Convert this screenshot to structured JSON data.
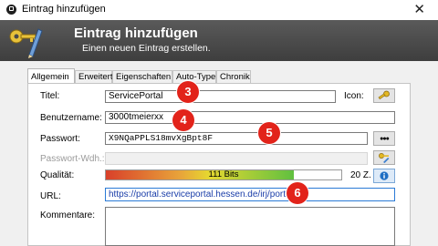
{
  "window": {
    "title": "Eintrag hinzufügen",
    "close_glyph": "✕"
  },
  "banner": {
    "title": "Eintrag hinzufügen",
    "subtitle": "Einen neuen Eintrag erstellen.",
    "icon": "key-pen-icon"
  },
  "tabs": [
    {
      "label": "Allgemein",
      "active": true
    },
    {
      "label": "Erweitert",
      "active": false
    },
    {
      "label": "Eigenschaften",
      "active": false
    },
    {
      "label": "Auto-Type",
      "active": false
    },
    {
      "label": "Chronik",
      "active": false
    }
  ],
  "form": {
    "title_label": "Titel:",
    "title_value": "ServicePortal",
    "icon_label": "Icon:",
    "username_label": "Benutzername:",
    "username_value": "3000tmeierxx",
    "password_label": "Passwort:",
    "password_value": "X9NQaPPLS18mvXgBpt8F",
    "password_repeat_label": "Passwort-Wdh.:",
    "quality_label": "Qualität:",
    "quality_text": "111 Bits",
    "quality_fraction": 0.8,
    "quality_chars": "20 Z.",
    "url_label": "URL:",
    "url_value": "https://portal.serviceportal.hessen.de/irj/portal",
    "comments_label": "Kommentare:"
  },
  "buttons": {
    "show_password_glyph": "●●●"
  },
  "badges": [
    "3",
    "4",
    "5",
    "6"
  ],
  "colors": {
    "badge": "#e2231a",
    "banner": "#4a4a4a",
    "url_border": "#2a7ad6",
    "info_button": "#1f6fc4"
  }
}
